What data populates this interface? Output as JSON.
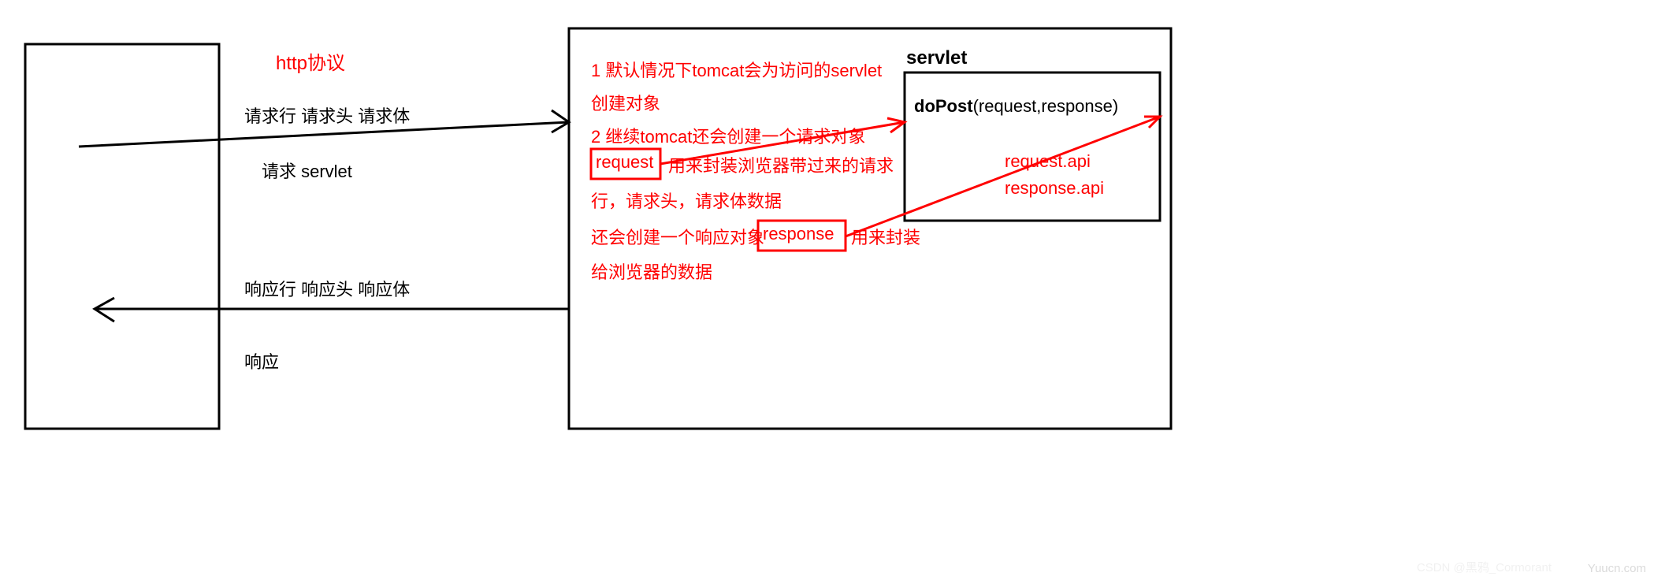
{
  "protocol_label": "http协议",
  "request_line_labels": "请求行  请求头   请求体",
  "request_action": "请求 servlet",
  "response_line_labels": "响应行 响应头 响应体",
  "response_action": "响应",
  "note_line1": "1 默认情况下tomcat会为访问的servlet",
  "note_line2": "创建对象",
  "note_line3": "2 继续tomcat还会创建一个请求对象",
  "note_request_box": "request",
  "note_line4_rest": "用来封装浏览器带过来的请求",
  "note_line5": "行，请求头，请求体数据",
  "note_line6_pre": "还会创建一个响应对象",
  "note_response_box": "response",
  "note_line6_post": "用来封装",
  "note_line7": "给浏览器的数据",
  "servlet_title": "servlet",
  "dopost_pre": "doPost",
  "dopost_args": "(request,response)",
  "api1": "request.api",
  "api2": "response.api",
  "watermark1": "CSDN @黑鸦_Cormorant",
  "watermark2": "Yuucn.com"
}
